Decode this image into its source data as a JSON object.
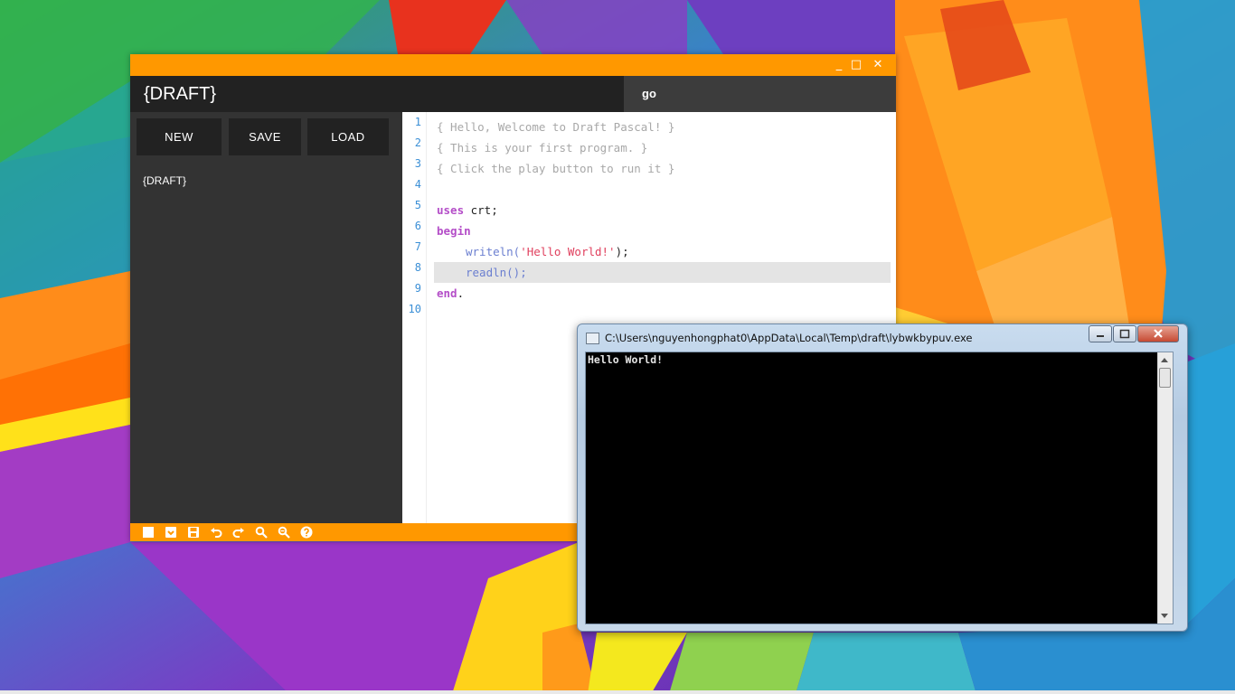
{
  "draft_window": {
    "app_title": "{DRAFT}",
    "tab_label": "go",
    "sidebar": {
      "buttons": {
        "new": "NEW",
        "save": "SAVE",
        "load": "LOAD"
      },
      "files": [
        "{DRAFT}"
      ]
    },
    "editor": {
      "line_numbers": [
        "1",
        "2",
        "3",
        "4",
        "5",
        "6",
        "7",
        "8",
        "9",
        "10"
      ],
      "comments": [
        "{ Hello, Welcome to Draft Pascal! }",
        "{ This is your first program. }",
        "{ Click the play button to run it }"
      ],
      "uses_keyword": "uses",
      "uses_rest": " crt;",
      "begin_keyword": "begin",
      "writeln_fn": "writeln(",
      "writeln_str": "'Hello World!'",
      "writeln_end": ");",
      "readln_fn": "readln();",
      "end_keyword": "end",
      "end_dot": "."
    },
    "toolbar_icons": [
      "new-file-icon",
      "open-icon",
      "save-icon",
      "undo-icon",
      "redo-icon",
      "search-icon",
      "replace-icon",
      "help-icon"
    ],
    "window_controls": {
      "minimize": "_",
      "maximize": "□",
      "close": "✕"
    }
  },
  "console_window": {
    "title": "C:\\Users\\nguyenhongphat0\\AppData\\Local\\Temp\\draft\\lybwkbypuv.exe",
    "output": "Hello World!"
  },
  "colors": {
    "accent": "#ff9800",
    "header": "#222222",
    "sidebar": "#333333",
    "keyword": "#b44ec8",
    "string": "#e0405e",
    "function": "#6b7fd0",
    "comment": "#a8a8a8",
    "line_number": "#3b8fd6"
  }
}
